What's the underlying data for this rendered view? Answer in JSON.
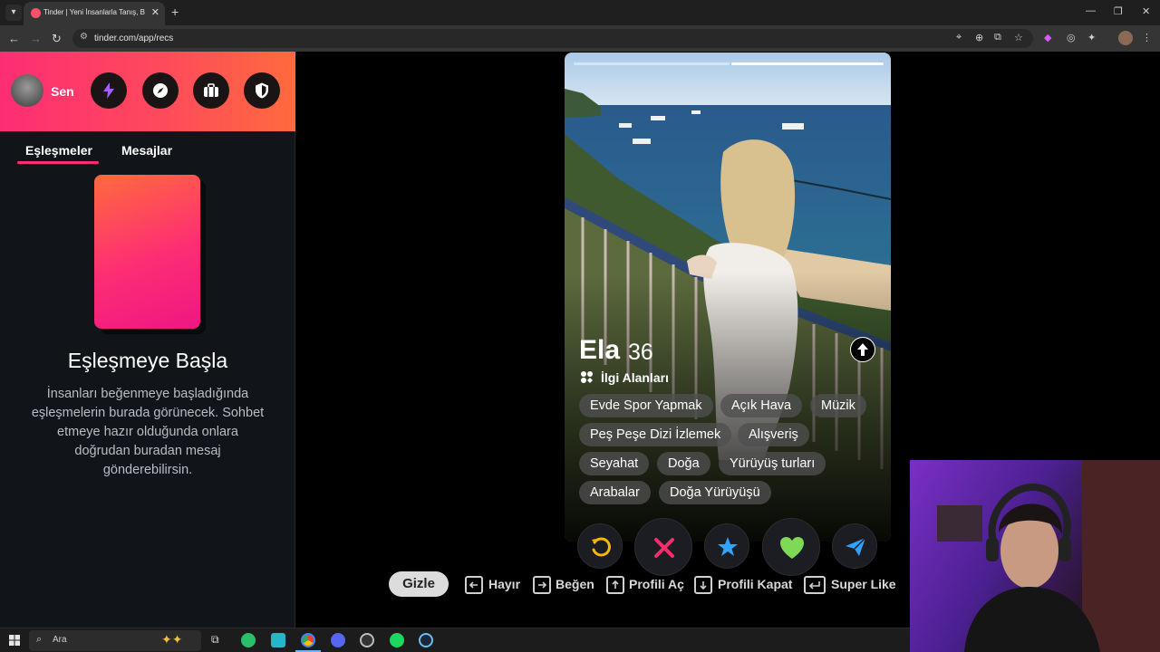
{
  "browser": {
    "tab_title": "Tinder | Yeni İnsanlarla Tanış, Bu",
    "url": "tinder.com/app/recs"
  },
  "sidebar": {
    "user_label": "Sen",
    "tabs": [
      "Eşleşmeler",
      "Mesajlar"
    ],
    "empty_title": "Eşleşmeye Başla",
    "empty_desc": "İnsanları beğenmeye başladığında eşleşmelerin burada görünecek. Sohbet etmeye hazır olduğunda onlara doğrudan buradan mesaj gönderebilirsin."
  },
  "profile": {
    "name": "Ela",
    "age": "36",
    "interests_label": "İlgi Alanları",
    "interests": [
      "Evde Spor Yapmak",
      "Açık Hava",
      "Müzik",
      "Peş Peşe Dizi İzlemek",
      "Alışveriş",
      "Seyahat",
      "Doğa",
      "Yürüyüş turları",
      "Arabalar",
      "Doğa Yürüyüşü"
    ],
    "photo_count": 2,
    "current_photo": 2
  },
  "actions": {
    "icons": [
      "rewind-icon",
      "nope-icon",
      "super-like-icon",
      "like-icon",
      "boost-icon"
    ]
  },
  "shortcuts": {
    "hide_label": "Gizle",
    "items": [
      "Hayır",
      "Beğen",
      "Profili Aç",
      "Profili Kapat",
      "Super Like"
    ]
  },
  "taskbar": {
    "search_label": "Ara"
  },
  "colors": {
    "brand_gradient_start": "#fd2d74",
    "brand_gradient_end": "#ff6a3d",
    "like_green": "#7ed957",
    "nope_pink": "#ff2b6e",
    "super_blue": "#2fa3ff",
    "rewind_yellow": "#f5b700"
  }
}
